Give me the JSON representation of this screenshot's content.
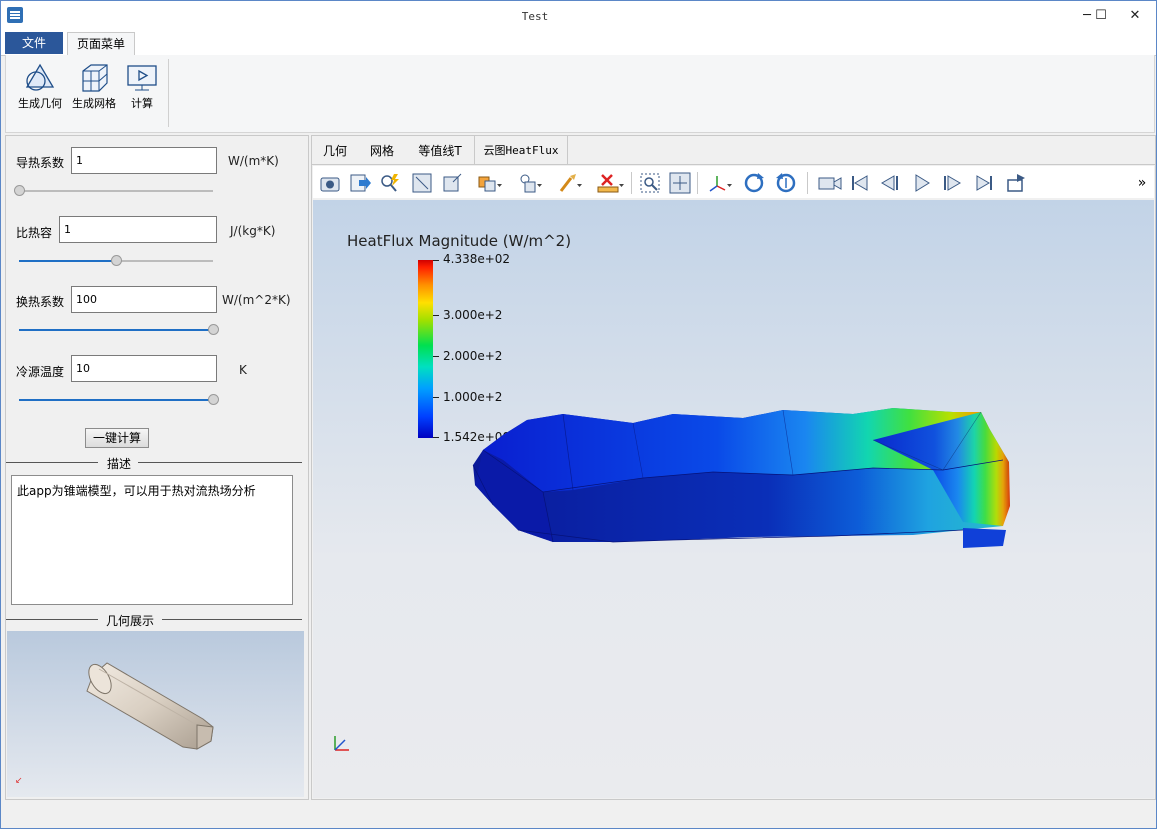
{
  "window": {
    "title": "Test",
    "minimize": "─",
    "maximize": "☐",
    "close": "✕"
  },
  "menu": {
    "file": "文件",
    "page_menu": "页面菜单"
  },
  "ribbon": [
    {
      "label": "生成几何",
      "icon": "geometry-icon"
    },
    {
      "label": "生成网格",
      "icon": "mesh-icon"
    },
    {
      "label": "计算",
      "icon": "compute-icon"
    }
  ],
  "params": [
    {
      "label": "导热系数",
      "value": "1",
      "unit": "W/(m*K)",
      "slider_level": 0.0
    },
    {
      "label": "比热容",
      "value": "1",
      "unit": "J/(kg*K)",
      "slider_level": 0.5
    },
    {
      "label": "换热系数",
      "value": "100",
      "unit": "W/(m^2*K)",
      "slider_level": 1.0
    },
    {
      "label": "冷源温度",
      "value": "10",
      "unit": "K",
      "slider_level": 1.0
    }
  ],
  "calc_button": "一键计算",
  "description": {
    "title": "描述",
    "text": "此app为锥端模型，可以用于热对流热场分析"
  },
  "geometry_preview": {
    "title": "几何展示"
  },
  "tabs": [
    "几何",
    "网格",
    "等值线T",
    "云图HeatFlux"
  ],
  "toolbar_overflow": "»",
  "legend": {
    "title": "HeatFlux Magnitude (W/m^2)",
    "labels": [
      "4.338e+02",
      "3.000e+2",
      "2.000e+2",
      "1.000e+2",
      "1.542e+00"
    ]
  },
  "colors": {
    "accent": "#2b579a",
    "slider": "#1f6fc5"
  }
}
